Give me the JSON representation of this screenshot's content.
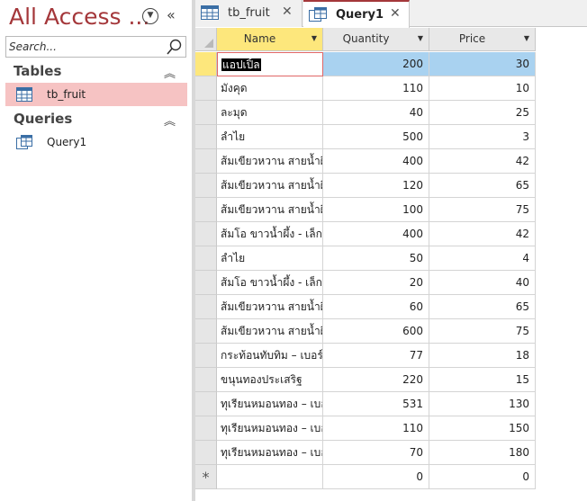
{
  "nav": {
    "title": "All Access ...",
    "search_placeholder": "Search...",
    "groups": [
      {
        "label": "Tables",
        "items": [
          {
            "label": "tb_fruit",
            "selected": true
          }
        ]
      },
      {
        "label": "Queries",
        "items": [
          {
            "label": "Query1",
            "selected": false
          }
        ]
      }
    ]
  },
  "tabs": [
    {
      "label": "tb_fruit",
      "active": false
    },
    {
      "label": "Query1",
      "active": true
    }
  ],
  "grid": {
    "columns": [
      "Name",
      "Quantity",
      "Price"
    ],
    "rows": [
      {
        "name": "แอปเปิ้ล",
        "quantity": "200",
        "price": "30"
      },
      {
        "name": "มังคุด",
        "quantity": "110",
        "price": "10"
      },
      {
        "name": "ละมุด",
        "quantity": "40",
        "price": "25"
      },
      {
        "name": "ลำไย",
        "quantity": "500",
        "price": "3"
      },
      {
        "name": "ส้มเขียวหวาน สายน้ำผึ้ง",
        "quantity": "400",
        "price": "42"
      },
      {
        "name": "ส้มเขียวหวาน สายน้ำผึ้ง",
        "quantity": "120",
        "price": "65"
      },
      {
        "name": "ส้มเขียวหวาน สายน้ำผึ้ง",
        "quantity": "100",
        "price": "75"
      },
      {
        "name": "ส้มโอ ขาวน้ำผึ้ง - เล็ก",
        "quantity": "400",
        "price": "42"
      },
      {
        "name": "ลำไย",
        "quantity": "50",
        "price": "4"
      },
      {
        "name": "ส้มโอ ขาวน้ำผึ้ง - เล็ก",
        "quantity": "20",
        "price": "40"
      },
      {
        "name": "ส้มเขียวหวาน สายน้ำผึ้ง",
        "quantity": "60",
        "price": "65"
      },
      {
        "name": "ส้มเขียวหวาน สายน้ำผึ้ง",
        "quantity": "600",
        "price": "75"
      },
      {
        "name": "กระท้อนทับทิม – เบอร์ใหญ่",
        "quantity": "77",
        "price": "18"
      },
      {
        "name": "ขนุนทองประเสริฐ",
        "quantity": "220",
        "price": "15"
      },
      {
        "name": "ทุเรียนหมอนทอง – เบอร์ใหญ่",
        "quantity": "531",
        "price": "130"
      },
      {
        "name": "ทุเรียนหมอนทอง – เบอร์ใหญ่",
        "quantity": "110",
        "price": "150"
      },
      {
        "name": "ทุเรียนหมอนทอง – เบอร์ใหญ่",
        "quantity": "70",
        "price": "180"
      }
    ],
    "new_row": {
      "marker": "*",
      "quantity": "0",
      "price": "0"
    }
  },
  "colors": {
    "accent": "#a4373a",
    "selected_nav": "#f6c3c3",
    "current_row": "#a9d2f0",
    "header_selected": "#fde77c"
  }
}
